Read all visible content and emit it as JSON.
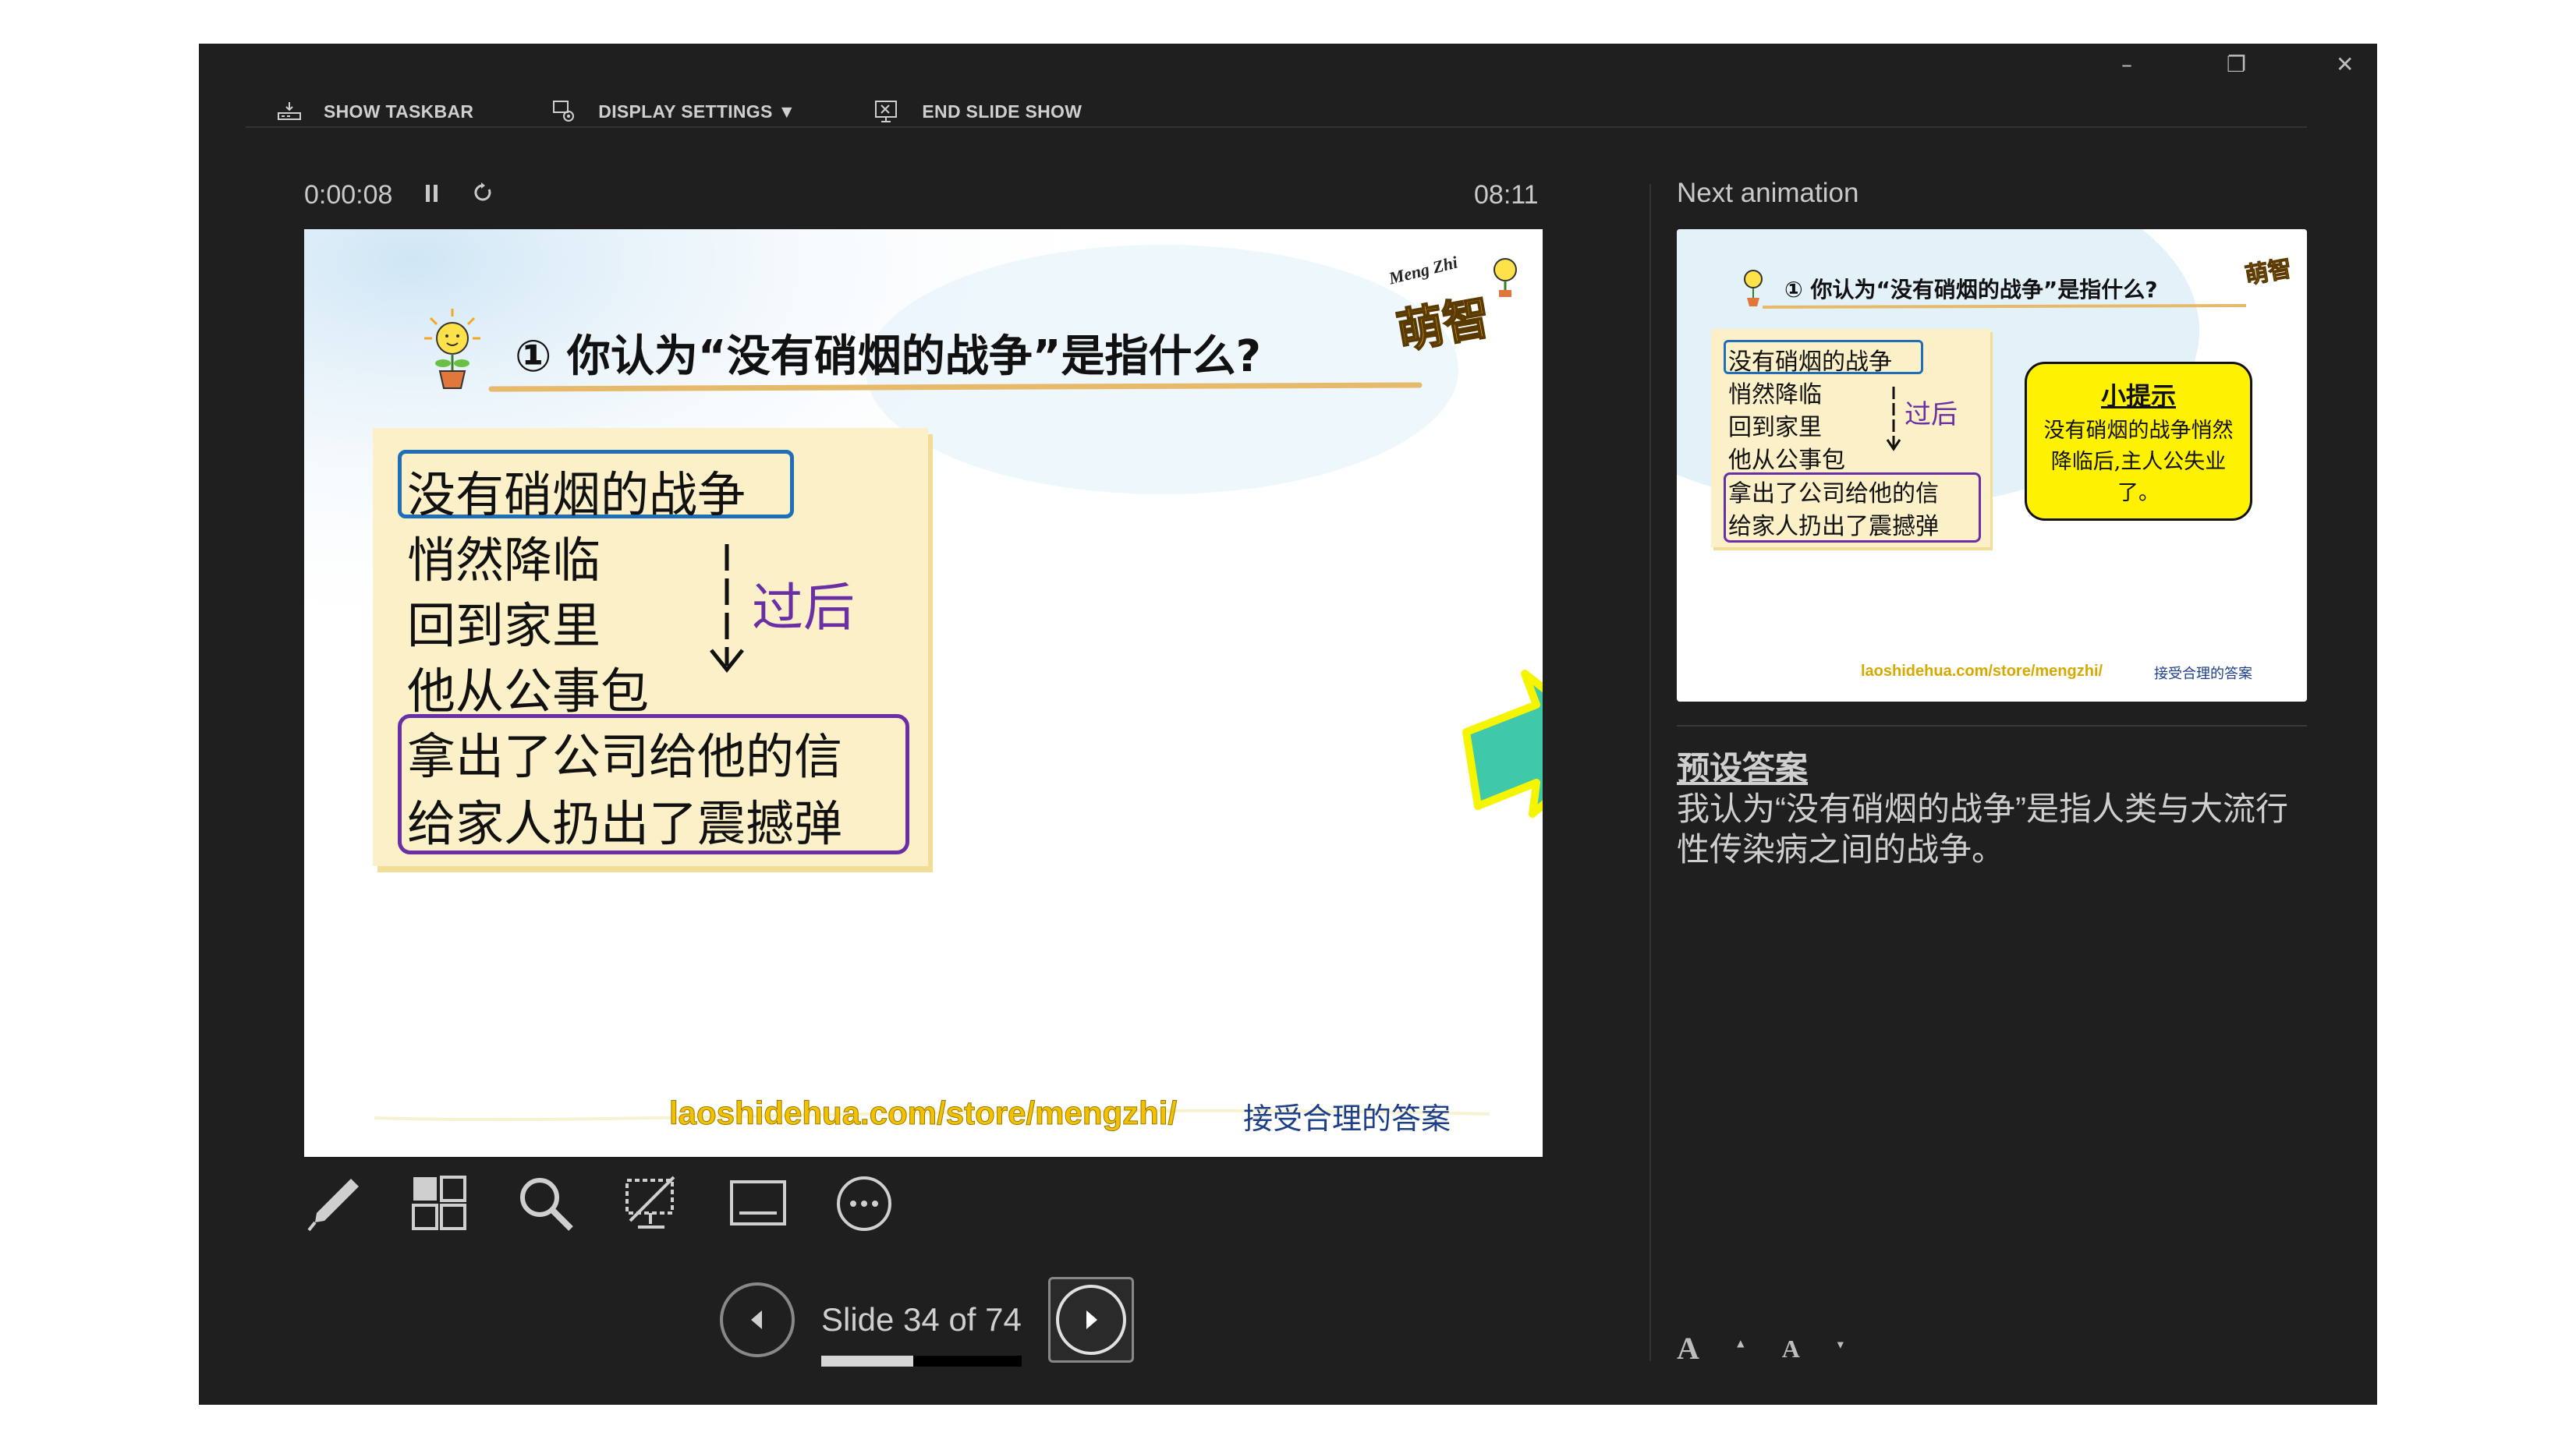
{
  "window": {
    "minimize_glyph": "–",
    "restore_glyph": "❐",
    "close_glyph": "✕",
    "bg_color": "#1f1f1f"
  },
  "toolbar": {
    "show_taskbar": "SHOW TASKBAR",
    "display_settings": "DISPLAY SETTINGS ▼",
    "end_slide_show": "END SLIDE SHOW"
  },
  "timer": {
    "elapsed": "0:00:08",
    "clock": "08:11"
  },
  "slide": {
    "number_title": "① 你认为“没有硝烟的战争”是指什么?",
    "brand_en": "Meng Zhi",
    "brand_cn": "萌智",
    "lines": [
      "没有硝烟的战争",
      "悄然降临",
      "回到家里",
      "他从公事包",
      "拿出了公司给他的信",
      "给家人扔出了震撼弹"
    ],
    "annotation": "过后",
    "footer_url": "laoshidehua.com/store/mengzhi/",
    "footer_note": "接受合理的答案",
    "accent_blue": "#1e6fb8",
    "accent_purple": "#6b2fa5",
    "card_color": "#fbf0c8",
    "arrow_color": "#3fc9a8"
  },
  "nav": {
    "slide_label": "Slide 34 of 74",
    "current": 34,
    "total": 74
  },
  "next": {
    "label": "Next animation",
    "hint_title": "小提示",
    "hint_text": "没有硝烟的战争悄然降临后,主人公失业了。",
    "hint_color": "#fff200"
  },
  "notes": {
    "heading": "预设答案",
    "text": "我认为“没有硝烟的战争”是指人类与大流行性传染病之间的战争。"
  },
  "font_buttons": {
    "increase": "A",
    "decrease": "A"
  },
  "icons": [
    "taskbar-icon",
    "display-settings-icon",
    "end-show-icon",
    "pause-icon",
    "reset-icon",
    "pen-icon",
    "grid-icon",
    "zoom-icon",
    "screen-icon",
    "subtitle-icon",
    "more-icon",
    "prev-icon",
    "next-icon",
    "lightbulb-icon",
    "font-increase-icon",
    "font-decrease-icon"
  ]
}
